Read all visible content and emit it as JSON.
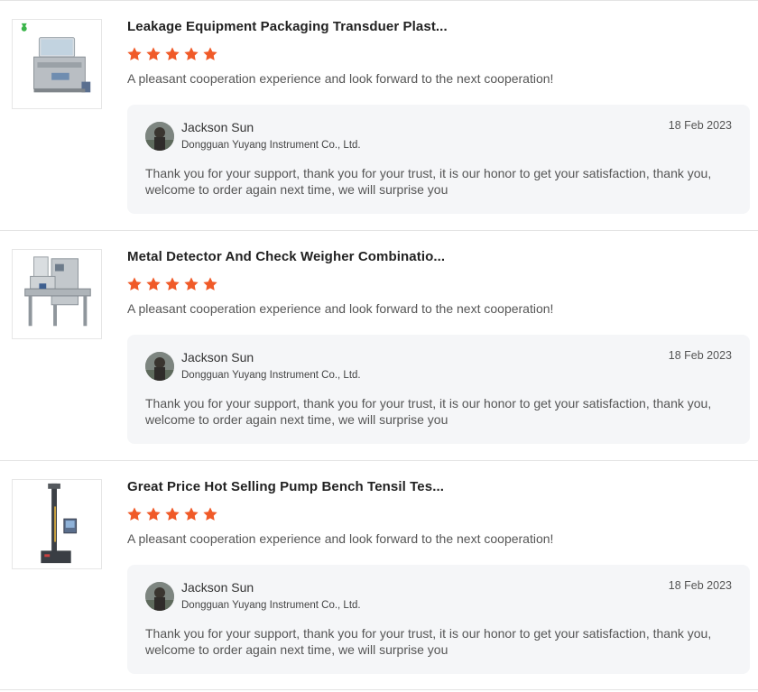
{
  "colors": {
    "star": "#f05a28",
    "reply_bg": "#f5f6f8",
    "divider": "#e3e3e3"
  },
  "reviews": [
    {
      "product_title": "Leakage Equipment Packaging Transduer Plast...",
      "rating": 5,
      "review_text": "A pleasant cooperation experience and look forward to the next cooperation!",
      "reply": {
        "name": "Jackson Sun",
        "company": "Dongguan Yuyang Instrument Co., Ltd.",
        "date": "18 Feb 2023",
        "text": "Thank you for your support, thank you for your trust, it is our honor to get your satisfaction, thank you, welcome to order again next time, we will surprise you"
      }
    },
    {
      "product_title": "Metal Detector And Check Weigher Combinatio...",
      "rating": 5,
      "review_text": "A pleasant cooperation experience and look forward to the next cooperation!",
      "reply": {
        "name": "Jackson Sun",
        "company": "Dongguan Yuyang Instrument Co., Ltd.",
        "date": "18 Feb 2023",
        "text": "Thank you for your support, thank you for your trust, it is our honor to get your satisfaction, thank you, welcome to order again next time, we will surprise you"
      }
    },
    {
      "product_title": "Great Price Hot Selling Pump Bench Tensil Tes...",
      "rating": 5,
      "review_text": "A pleasant cooperation experience and look forward to the next cooperation!",
      "reply": {
        "name": "Jackson Sun",
        "company": "Dongguan Yuyang Instrument Co., Ltd.",
        "date": "18 Feb 2023",
        "text": "Thank you for your support, thank you for your trust, it is our honor to get your satisfaction, thank you, welcome to order again next time, we will surprise you"
      }
    }
  ]
}
